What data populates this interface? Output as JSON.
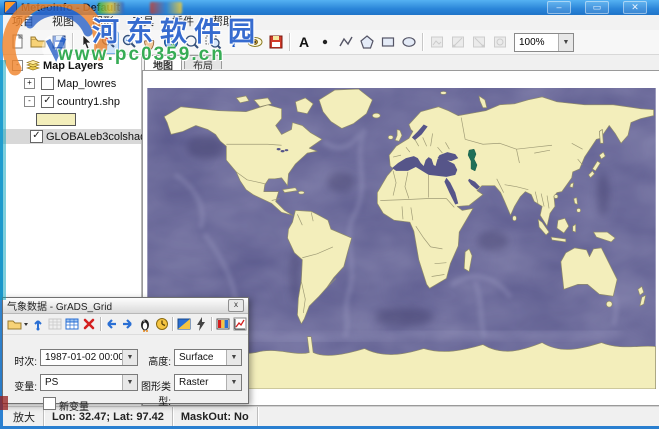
{
  "window": {
    "title": "MeteoInfo - Default",
    "minimize": "–",
    "maximize": "▭",
    "close": "✕"
  },
  "menu": {
    "items": [
      "项目",
      "视图",
      "图形",
      "工具",
      "插件",
      "帮助"
    ]
  },
  "toolbar": {
    "zoom_level": "100%"
  },
  "tabs": {
    "map": "地图",
    "layout": "布局"
  },
  "layers_panel": {
    "root_label": "Map Layers",
    "items": [
      {
        "label": "Map_lowres",
        "expander": "+",
        "checked": false
      },
      {
        "label": "country1.shp",
        "expander": "-",
        "checked": true,
        "legend_swatch_color": "#f3eebb"
      },
      {
        "label": "GLOBALeb3colshade.jpg",
        "checked": true,
        "selected": true
      }
    ]
  },
  "dialog": {
    "title": "气象数据 - GrADS_Grid",
    "close": "x",
    "time_label": "时次:",
    "time_value": "1987-01-02 00:00",
    "level_label": "高度:",
    "level_value": "Surface",
    "variable_label": "变量:",
    "variable_value": "PS",
    "graph_type_label": "图形类型:",
    "graph_type_value": "Raster",
    "new_variable_label": "新变量"
  },
  "status": {
    "tool": "放大",
    "coordinates": "Lon: 32.47; Lat: 97.42",
    "maskout": "MaskOut: No"
  },
  "watermark": {
    "site_name": "河东软件园",
    "site_url": "www.pc0359.cn"
  },
  "map": {
    "land_color": "#f3eebb",
    "ocean_color": "#565589",
    "caspian_color": "#1f6f58",
    "country_border_color": "#97936f"
  }
}
